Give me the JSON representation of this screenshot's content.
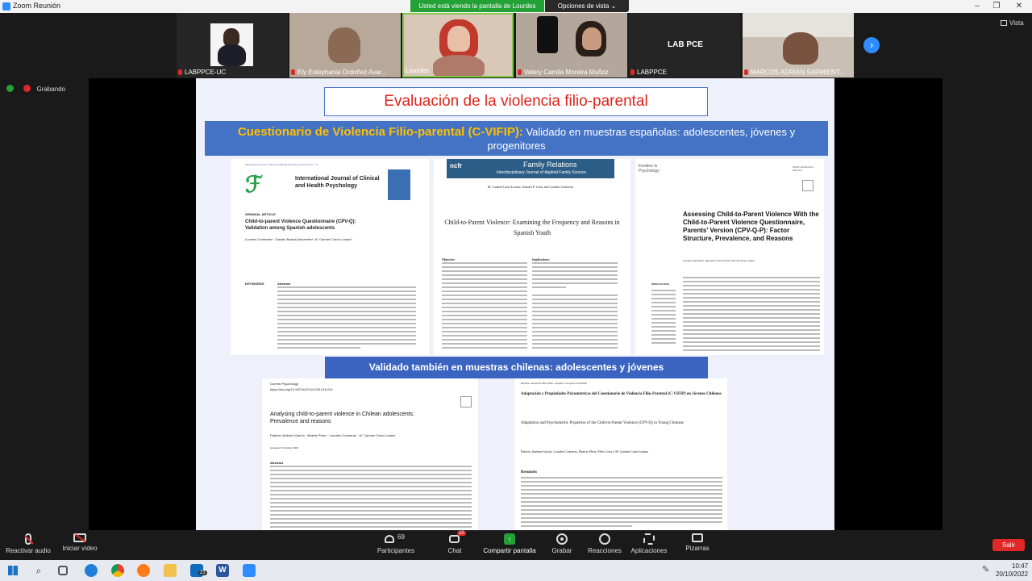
{
  "window": {
    "title": "Zoom Reunión"
  },
  "share_banner": {
    "text": "Usted está viendo la pantalla de Lourdes",
    "options": "Opciones de vista"
  },
  "gallery": {
    "view_label": "Vista",
    "tiles": [
      {
        "name": "LABPPCE-UC"
      },
      {
        "name": "Ely Estephania Ordoñez Avar..."
      },
      {
        "name": "Lourdes"
      },
      {
        "name": "Valery Camila Moreira Muñoz"
      },
      {
        "name": "LABPPCE"
      },
      {
        "name": "MARCOS ADRIAN SARMIENT..."
      }
    ],
    "lab_logo": "LAB PCE"
  },
  "recording": {
    "label": "Grabando"
  },
  "slide": {
    "title": "Evaluación de la violencia filio-parental",
    "band_bold": "Cuestionario de Violencia Filio-parental (C-VIFIP):",
    "band_rest": " Validado en muestras españolas: adolescentes, jóvenes y progenitores",
    "chile_band": "Validado también en muestras chilenas: adolescentes y jóvenes",
    "papers": {
      "p1": {
        "journal_top": "International Journal of Clinical and Health Psychology (2019) 19, 67—74",
        "journal": "International Journal of Clinical and Health Psychology",
        "section": "ORIGINAL ARTICLE",
        "title": "Child-to-parent Violence Questionnaire (CPV-Q): Validation among Spanish adolescents",
        "authors": "Lourdes Contreras*, Claudio Bustos-Navarrete*, M. Carmen Cano-Lozano*",
        "keywords": "KEYWORDS",
        "abstract_label": "Abstract"
      },
      "p2": {
        "header": "Family Relations",
        "subheader": "Interdisciplinary Journal of Applied Family Science",
        "brand": "ncfr",
        "authors": "M. Carmen Cano-Lozano, Samuel P. León, and Lourdes Contreras",
        "title": "Child-to-Parent Violence: Examining the Frequency and Reasons in Spanish Youth",
        "objective_label": "Objective:",
        "implications_label": "Implications:"
      },
      "p3": {
        "brand": "frontiers in Psychology",
        "header_right": "BRIEF RESEARCH REPORT",
        "title": "Assessing Child-to-Parent Violence With the Child-to-Parent Violence Questionnaire, Parents' Version (CPV-Q-P): Factor Structure, Prevalence, and Reasons",
        "authors": "Lourdes Contreras*, Samuel P. León and M. Carmen Cano-Lozano",
        "open_access": "OPEN ACCESS"
      },
      "p4": {
        "journal": "Current Psychology",
        "doi": "https://doi.org/10.1007/s12144-020-01113-6",
        "title": "Analysing child-to-parent violence in Chilean adolescents: Prevalence and reasons",
        "authors": "Patricia Jiménez-García · Beatriz Pérez · Lourdes Contreras · M. Carmen Cano-Lozano",
        "accepted": "Accepted: 9 October 2020",
        "abstract_label": "Abstract"
      },
      "p5": {
        "received": "Recibido / Received: 08.01.2020 - Aceptado / Accepted: 03.04.2020",
        "title": "Adaptación y Propiedades Psicométricas del Cuestionario de Violencia Filio-Parental (C-VIFIP) en Jóvenes Chilenos",
        "title_en": "Adaptation and Psychometric Properties of the Child-to-Parent Violence (CPV-Q) in Young Chileans",
        "authors": "Patricia Jiménez-García, Lourdes Contreras, Beatriz Pérez, Félix Cova y M. Carmen Cano-Lozano",
        "resumen_label": "Resumen"
      }
    }
  },
  "toolbar": {
    "audio": "Reactivar audio",
    "video": "Iniciar vídeo",
    "participants": "Participantes",
    "participants_count": "69",
    "chat": "Chat",
    "chat_badge": "10",
    "share": "Compartir pantalla",
    "record": "Grabar",
    "reactions": "Reacciones",
    "apps": "Aplicaciones",
    "whiteboards": "Pizarras",
    "leave": "Salir"
  },
  "taskbar": {
    "time": "10:47",
    "date": "20/10/2022",
    "mail_badge": "21"
  },
  "colors": {
    "zoom_blue": "#2d8cff",
    "share_green": "#23a036",
    "slide_title_red": "#e2231a",
    "band_blue": "#4472c4",
    "band_yellow": "#ffc000",
    "leave_red": "#e02828"
  }
}
